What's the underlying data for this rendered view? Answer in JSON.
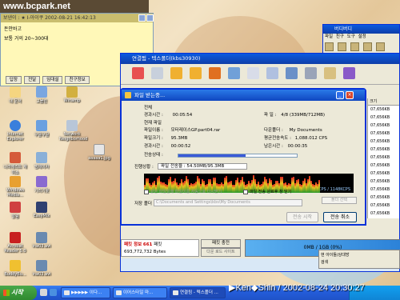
{
  "watermark": {
    "url": "www.bcpark.net",
    "stamp": "▶Ken◆Shin / 2002-08-24 20:30:27"
  },
  "memo": {
    "title": "보낸이 : ★  I-아이쿠        2002-08-21 16:42:13",
    "line1": "돈안바고",
    "line2": "보통 거의 20~300대",
    "buttons": [
      "답장",
      "전달",
      "임대설",
      "친구정보"
    ]
  },
  "messenger": {
    "title": "버디버디",
    "menu": [
      "파일",
      "친구",
      "도구",
      "설정"
    ]
  },
  "main_window": {
    "title": "연결됨 - 텍스폴더(kbs30930)",
    "list_header": "크기",
    "list_rows": [
      "07,656KB",
      "07,656KB",
      "07,656KB",
      "07,656KB",
      "07,656KB",
      "07,656KB",
      "07,656KB",
      "07,656KB",
      "07,656KB",
      "07,656KB",
      "07,656KB",
      "07,656KB",
      "07,656KB",
      "07,656KB"
    ],
    "status": {
      "label": "패킷 정보",
      "count": "661",
      "unit": "패킷",
      "bytes": "693,772,732 Bytes"
    },
    "mid_buttons": [
      "패킷 충전",
      "다운 로드 사이트"
    ],
    "usage": "0MB / 1GB (0%)",
    "userlist_top": "현 아이들/상대방",
    "userlist_bottom": "검색"
  },
  "dialog": {
    "title": "파일 받는중...",
    "section_label": "전체",
    "fields": {
      "elapsed_label": "경과시간 :",
      "elapsed": "00:05:54",
      "files_label": "파 일 :",
      "files": "4/8 (339MB/712MB)",
      "current_label": "현재 파일",
      "filename_label": "파일이름 :",
      "filename": "모터레이스GP.part04.rar",
      "target_label": "다운폴더 :",
      "target": "My Documents",
      "filesize_label": "파일크기 :",
      "filesize": "95.3MB",
      "avg_label": "평균전송속도 :",
      "avg": "1,088.012 CPS",
      "elapsed2_label": "경과시간 :",
      "elapsed2": "00:00:52",
      "remain_label": "남은시간 :",
      "remain": "00:00:35",
      "state_label": "전송상태 :",
      "progress_label": "진행상황 :",
      "progress_text": "파일 전송율 : 54.50MB/95.3MB",
      "rate_text": "1079KCPS / 1148KCPS"
    },
    "progress_fraction": 0.57,
    "options": {
      "opt1": "같은 파일일때 파일이름 자동으로 다시받기",
      "opt2": "파일 전송 완료후 창 닫기",
      "folder_btn": "폴더 선택"
    },
    "path_label": "저장 폴더 :",
    "path": "C:\\Documents and Settings\\kbs\\My Documents",
    "buttons": {
      "cancel_dl": "전송 시작",
      "cancel": "전송 취소"
    }
  },
  "desktop_icons": [
    {
      "label": "내 문서"
    },
    {
      "label": "고블린"
    },
    {
      "label": "Winamp"
    },
    {
      "label": "Internet Explorer"
    },
    {
      "label": "구글구글"
    },
    {
      "label": "Network Neighborhood"
    },
    {
      "label": "나라에리트 재미소"
    },
    {
      "label": "엠제이자"
    },
    {
      "label": "aaaaa1.jpg"
    },
    {
      "label": "Windows Media..."
    },
    {
      "label": "기러기봇"
    },
    {
      "label": "알림"
    },
    {
      "label": "EasyMix"
    },
    {
      "label": "Acrobat Reader 5.0"
    },
    {
      "label": "ina03.avi"
    },
    {
      "label": "BuddyBu..."
    },
    {
      "label": "ina03.avi"
    }
  ],
  "taskbar": {
    "start": "시작",
    "items": [
      "▶▶▶▶▶ 이다...",
      "이어스타일 마...",
      "연결됨 - 텍스폴더 ..."
    ]
  }
}
